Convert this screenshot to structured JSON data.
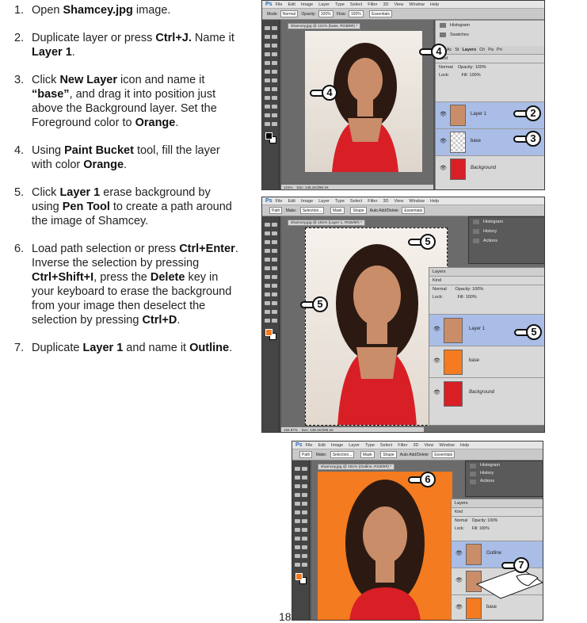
{
  "steps": [
    {
      "num": "1.",
      "parts": [
        [
          "Open ",
          false
        ],
        [
          "Shamcey.jpg",
          true
        ],
        [
          " image.",
          false
        ]
      ]
    },
    {
      "num": "2.",
      "parts": [
        [
          "Duplicate layer or press ",
          false
        ],
        [
          "Ctrl+J.",
          true
        ],
        [
          " Name it ",
          false
        ],
        [
          "Layer 1",
          true
        ],
        [
          ".",
          false
        ]
      ]
    },
    {
      "num": "3.",
      "parts": [
        [
          "Click ",
          false
        ],
        [
          "New Layer",
          true
        ],
        [
          " icon and name it ",
          false
        ],
        [
          "“base”",
          true
        ],
        [
          ", and drag it into position just above the Background layer. Set the Foreground color to ",
          false
        ],
        [
          "Orange",
          true
        ],
        [
          ".",
          false
        ]
      ]
    },
    {
      "num": "4.",
      "parts": [
        [
          "Using ",
          false
        ],
        [
          "Paint Bucket",
          true
        ],
        [
          " tool, fill the layer with color ",
          false
        ],
        [
          "Orange",
          true
        ],
        [
          ".",
          false
        ]
      ]
    },
    {
      "num": "5.",
      "parts": [
        [
          "Click ",
          false
        ],
        [
          "Layer 1",
          true
        ],
        [
          " erase background by using ",
          false
        ],
        [
          "Pen Tool",
          true
        ],
        [
          " to create a path around the image of Shamcey.",
          false
        ]
      ]
    },
    {
      "num": "6.",
      "parts": [
        [
          "Load path selection or press ",
          false
        ],
        [
          "Ctrl+Enter",
          true
        ],
        [
          ". Inverse the selection by pressing ",
          false
        ],
        [
          "Ctrl+Shift+I",
          true
        ],
        [
          ",  press the ",
          false
        ],
        [
          "Delete",
          true
        ],
        [
          " key in your keyboard to erase the background from your image then deselect the selection by pressing ",
          false
        ],
        [
          "Ctrl+D",
          true
        ],
        [
          ".",
          false
        ]
      ]
    },
    {
      "num": "7.",
      "parts": [
        [
          "Duplicate ",
          false
        ],
        [
          "Layer 1",
          true
        ],
        [
          " and name it ",
          false
        ],
        [
          "Outline",
          true
        ],
        [
          ".",
          false
        ]
      ]
    }
  ],
  "colors": {
    "orange": "#f47b20",
    "selection": "#a9bde6",
    "ui_dark": "#535353"
  },
  "shot1": {
    "menu": [
      "Ps",
      "File",
      "Edit",
      "Image",
      "Layer",
      "Type",
      "Select",
      "Filter",
      "3D",
      "View",
      "Window",
      "Help"
    ],
    "options": {
      "mode_label": "Mode:",
      "mode_value": "Normal",
      "opacity_label": "Opacity:",
      "opacity_value": "100%",
      "flow_label": "Flow:",
      "flow_value": "100%",
      "workspace": "Essentials"
    },
    "doc_tab": "shamcey.jpg @ 121% (base, RGB/8#) *",
    "status_zoom": "121%",
    "status_doc": "Doc: 145.1K/296.1K",
    "panel_items": [
      "Histogram",
      "Swatches"
    ],
    "layer_tabs": [
      "Lit",
      "Ac",
      "St",
      "Layers",
      "Ch",
      "Pa",
      "Pri"
    ],
    "kind": "Kind",
    "blend": "Normal",
    "opacity_label": "Opacity:",
    "opacity": "100%",
    "lock_label": "Lock:",
    "fill_label": "Fill:",
    "fill": "100%",
    "layers": [
      "Layer 1",
      "base",
      "Background"
    ],
    "callouts": [
      "4",
      "4",
      "2",
      "3"
    ]
  },
  "shot2": {
    "menu": [
      "Ps",
      "File",
      "Edit",
      "Image",
      "Layer",
      "Type",
      "Select",
      "Filter",
      "3D",
      "View",
      "Window",
      "Help"
    ],
    "options": {
      "path_value": "Path",
      "make_label": "Make:",
      "sel": "Selection...",
      "mask": "Mask",
      "shape": "Shape",
      "auto": "Auto Add/Delete",
      "workspace": "Essentials"
    },
    "doc_tab": "shamcey.jpg @ 191% (Layer 1, RGB/8#) *",
    "status_zoom": "194.87%",
    "status_doc": "Doc: 148.1K/296.1K",
    "panel_items": [
      "Histogram",
      "History",
      "Actions"
    ],
    "layers_title": "Layers",
    "kind": "Kind",
    "blend": "Normal",
    "opacity_label": "Opacity:",
    "opacity": "100%",
    "lock_label": "Lock:",
    "fill_label": "Fill:",
    "fill": "100%",
    "layers": [
      "Layer 1",
      "base",
      "Background"
    ],
    "callouts": [
      "5",
      "5",
      "5"
    ]
  },
  "shot3": {
    "menu": [
      "Ps",
      "File",
      "Edit",
      "Image",
      "Layer",
      "Type",
      "Select",
      "Filter",
      "3D",
      "View",
      "Window",
      "Help"
    ],
    "options": {
      "path_value": "Path",
      "make_label": "Make:",
      "sel": "Selection...",
      "mask": "Mask",
      "shape": "Shape",
      "auto": "Auto Add/Delete",
      "workspace": "Essentials"
    },
    "doc_tab": "shamcey.jpg @ 191% (Outline, RGB/8#) *",
    "panel_items": [
      "Histogram",
      "History",
      "Actions"
    ],
    "layers_title": "Layers",
    "kind": "Kind",
    "blend": "Normal",
    "opacity_label": "Opacity:",
    "opacity": "100%",
    "lock_label": "Lock:",
    "fill_label": "Fill:",
    "fill": "100%",
    "layers": [
      "Outline",
      "",
      "base"
    ],
    "callouts": [
      "6",
      "7"
    ]
  },
  "page_number": "18"
}
